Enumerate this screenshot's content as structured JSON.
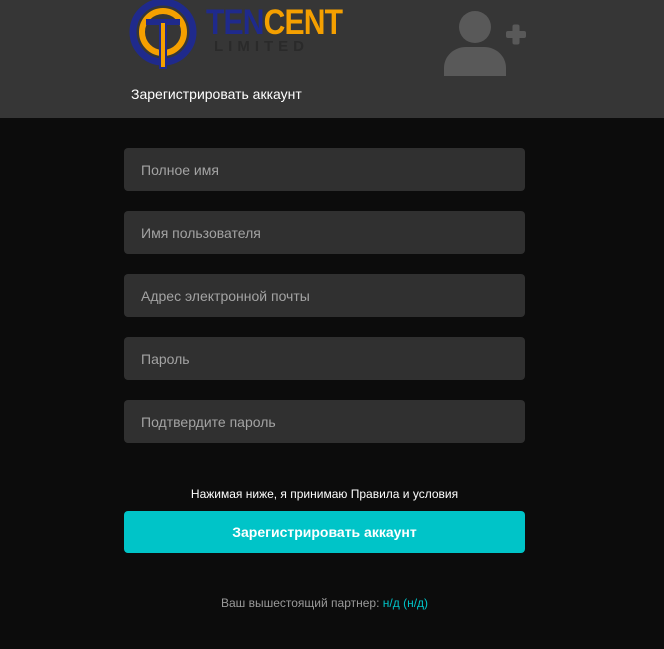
{
  "header": {
    "logo": {
      "word_left": "TEN",
      "word_right": "CENT",
      "sub": "LIMITED"
    },
    "title": "Зарегистрировать аккаунт"
  },
  "form": {
    "full_name_placeholder": "Полное имя",
    "username_placeholder": "Имя пользователя",
    "email_placeholder": "Адрес электронной почты",
    "password_placeholder": "Пароль",
    "confirm_password_placeholder": "Подтвердите пароль"
  },
  "terms_text": "Нажимая ниже, я принимаю Правила и условия",
  "submit_label": "Зарегистрировать аккаунт",
  "sponsor": {
    "label": "Ваш вышестоящий партнер:",
    "value": "н/д (н/д)"
  },
  "colors": {
    "header_bg": "#363636",
    "page_bg": "#0c0c0c",
    "field_bg": "#303030",
    "accent": "#00c4c8",
    "logo_blue": "#1f2a8c",
    "logo_orange": "#f5a000"
  },
  "icons": {
    "header_icon": "user-add-icon",
    "logo_icon": "tencent-logo-icon"
  }
}
